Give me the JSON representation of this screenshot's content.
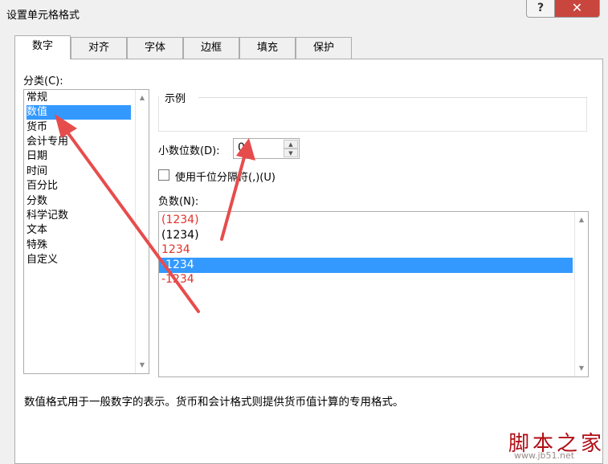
{
  "window": {
    "title": "设置单元格格式",
    "help_glyph": "?",
    "close_glyph": "✕"
  },
  "tabs": [
    {
      "label": "数字",
      "active": true
    },
    {
      "label": "对齐"
    },
    {
      "label": "字体"
    },
    {
      "label": "边框"
    },
    {
      "label": "填充"
    },
    {
      "label": "保护"
    }
  ],
  "category": {
    "label": "分类(C):",
    "selected_index": 1,
    "items": [
      "常规",
      "数值",
      "货币",
      "会计专用",
      "日期",
      "时间",
      "百分比",
      "分数",
      "科学记数",
      "文本",
      "特殊",
      "自定义"
    ]
  },
  "sample": {
    "label": "示例",
    "value": ""
  },
  "decimal": {
    "label": "小数位数(D):",
    "value": "0"
  },
  "thousands": {
    "label": "使用千位分隔符(,)(U)",
    "checked": false
  },
  "negative": {
    "label": "负数(N):",
    "selected_index": 3,
    "items": [
      {
        "text": "(1234)",
        "color": "#e0332b"
      },
      {
        "text": "(1234)",
        "color": "#000000"
      },
      {
        "text": "1234",
        "color": "#e0332b"
      },
      {
        "text": "-1234",
        "color": "#000000"
      },
      {
        "text": "-1234",
        "color": "#e0332b"
      }
    ]
  },
  "description": "数值格式用于一般数字的表示。货币和会计格式则提供货币值计算的专用格式。",
  "watermark": {
    "name": "脚本之家",
    "url": "www.jb51.net"
  },
  "colors": {
    "selection": "#3399ff",
    "annotation_arrow": "#e74c4c",
    "negative_red": "#e0332b",
    "close_button": "#c8463d"
  },
  "icons": {
    "scroll_up": "triangle-up",
    "scroll_down": "triangle-down"
  }
}
